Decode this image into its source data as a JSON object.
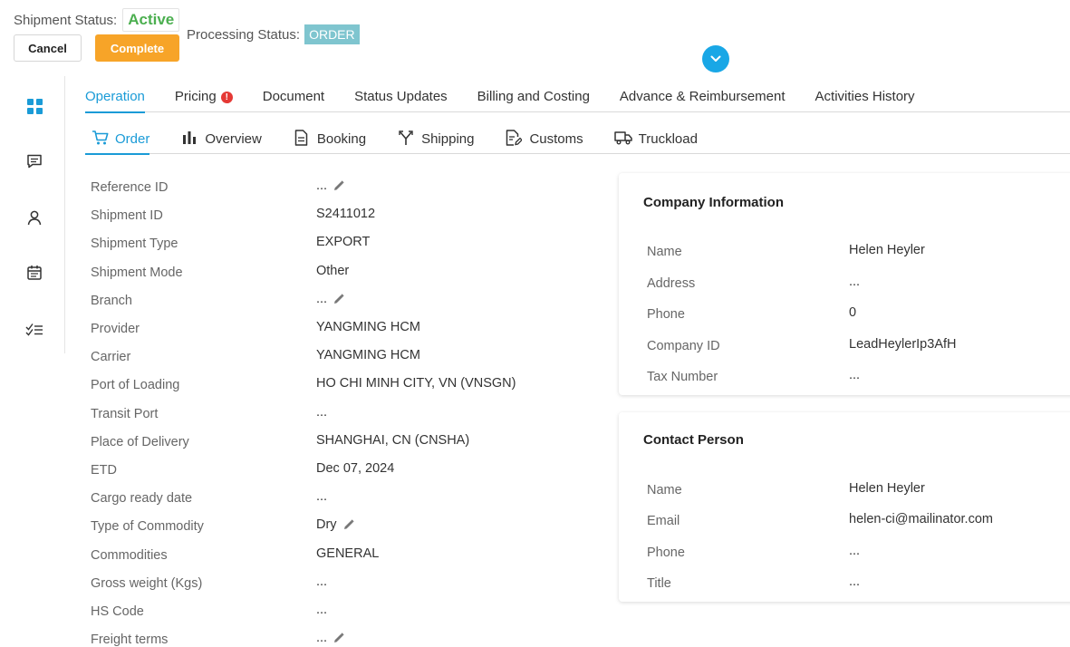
{
  "header": {
    "shipment_status_label": "Shipment Status:",
    "shipment_status_value": "Active",
    "cancel_label": "Cancel",
    "complete_label": "Complete",
    "processing_status_label": "Processing Status:",
    "processing_status_value": "ORDER"
  },
  "sidebar": {
    "items": [
      {
        "icon": "dashboard-icon"
      },
      {
        "icon": "comment-icon"
      },
      {
        "icon": "user-icon"
      },
      {
        "icon": "calendar-icon"
      },
      {
        "icon": "checklist-icon"
      }
    ]
  },
  "tabs": [
    {
      "label": "Operation",
      "active": true
    },
    {
      "label": "Pricing",
      "badge": "!"
    },
    {
      "label": "Document"
    },
    {
      "label": "Status Updates"
    },
    {
      "label": "Billing and Costing"
    },
    {
      "label": "Advance & Reimbursement"
    },
    {
      "label": "Activities History"
    }
  ],
  "subtabs": [
    {
      "label": "Order",
      "icon": "cart-icon",
      "active": true
    },
    {
      "label": "Overview",
      "icon": "bar-chart-icon"
    },
    {
      "label": "Booking",
      "icon": "document-icon"
    },
    {
      "label": "Shipping",
      "icon": "fork-icon"
    },
    {
      "label": "Customs",
      "icon": "edit-document-icon"
    },
    {
      "label": "Truckload",
      "icon": "truck-icon"
    }
  ],
  "fields": [
    {
      "label": "Reference ID",
      "value": "...",
      "editable": true
    },
    {
      "label": "Shipment ID",
      "value": "S2411012"
    },
    {
      "label": "Shipment Type",
      "value": "EXPORT"
    },
    {
      "label": "Shipment Mode",
      "value": "Other"
    },
    {
      "label": "Branch",
      "value": "...",
      "editable": true
    },
    {
      "label": "Provider",
      "value": "YANGMING HCM"
    },
    {
      "label": "Carrier",
      "value": "YANGMING HCM"
    },
    {
      "label": "Port of Loading",
      "value": "HO CHI MINH CITY, VN (VNSGN)"
    },
    {
      "label": "Transit Port",
      "value": "..."
    },
    {
      "label": "Place of Delivery",
      "value": "SHANGHAI, CN (CNSHA)"
    },
    {
      "label": "ETD",
      "value": "Dec 07, 2024"
    },
    {
      "label": "Cargo ready date",
      "value": "..."
    },
    {
      "label": "Type of Commodity",
      "value": "Dry",
      "editable": true
    },
    {
      "label": "Commodities",
      "value": "GENERAL"
    },
    {
      "label": "Gross weight (Kgs)",
      "value": "..."
    },
    {
      "label": "HS Code",
      "value": "..."
    },
    {
      "label": "Freight terms",
      "value": "...",
      "editable": true
    }
  ],
  "company": {
    "title": "Company Information",
    "rows": [
      {
        "label": "Name",
        "value": "Helen Heyler"
      },
      {
        "label": "Address",
        "value": "..."
      },
      {
        "label": "Phone",
        "value": "0"
      },
      {
        "label": "Company ID",
        "value": "LeadHeylerIp3AfH"
      },
      {
        "label": "Tax Number",
        "value": "..."
      }
    ]
  },
  "contact": {
    "title": "Contact Person",
    "rows": [
      {
        "label": "Name",
        "value": "Helen Heyler"
      },
      {
        "label": "Email",
        "value": "helen-ci@mailinator.com"
      },
      {
        "label": "Phone",
        "value": "..."
      },
      {
        "label": "Title",
        "value": "..."
      }
    ]
  },
  "colors": {
    "accent": "#1a9bd7",
    "complete": "#f7a428",
    "active_status": "#4caf50",
    "processing_badge": "#7fc5cf",
    "error_badge": "#e53935"
  }
}
